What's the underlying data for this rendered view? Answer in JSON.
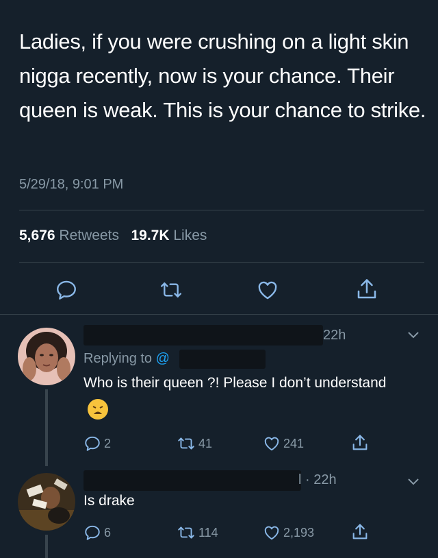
{
  "tweet": {
    "text": "Ladies, if you were crushing on a light skin nigga recently, now is your chance. Their queen is weak. This is your chance to strike.",
    "timestamp": "5/29/18, 9:01 PM",
    "retweets_count": "5,676",
    "retweets_label": "Retweets",
    "likes_count": "19.7K",
    "likes_label": "Likes",
    "actions": [
      "reply-icon",
      "retweet-icon",
      "like-icon",
      "share-icon"
    ]
  },
  "replies": [
    {
      "time": "22h",
      "replying_label": "Replying to",
      "text": "Who is their queen ?! Please I don’t understand",
      "emoji": "weary-face",
      "reply_count": "2",
      "retweet_count": "41",
      "like_count": "241"
    },
    {
      "time": "l · 22h",
      "text": "Is drake",
      "reply_count": "6",
      "retweet_count": "114",
      "like_count": "2,193"
    }
  ],
  "colors": {
    "background": "#15202b",
    "secondary_text": "#8899a6",
    "icon_blue": "#8ab8e8",
    "divider": "#38444d"
  }
}
